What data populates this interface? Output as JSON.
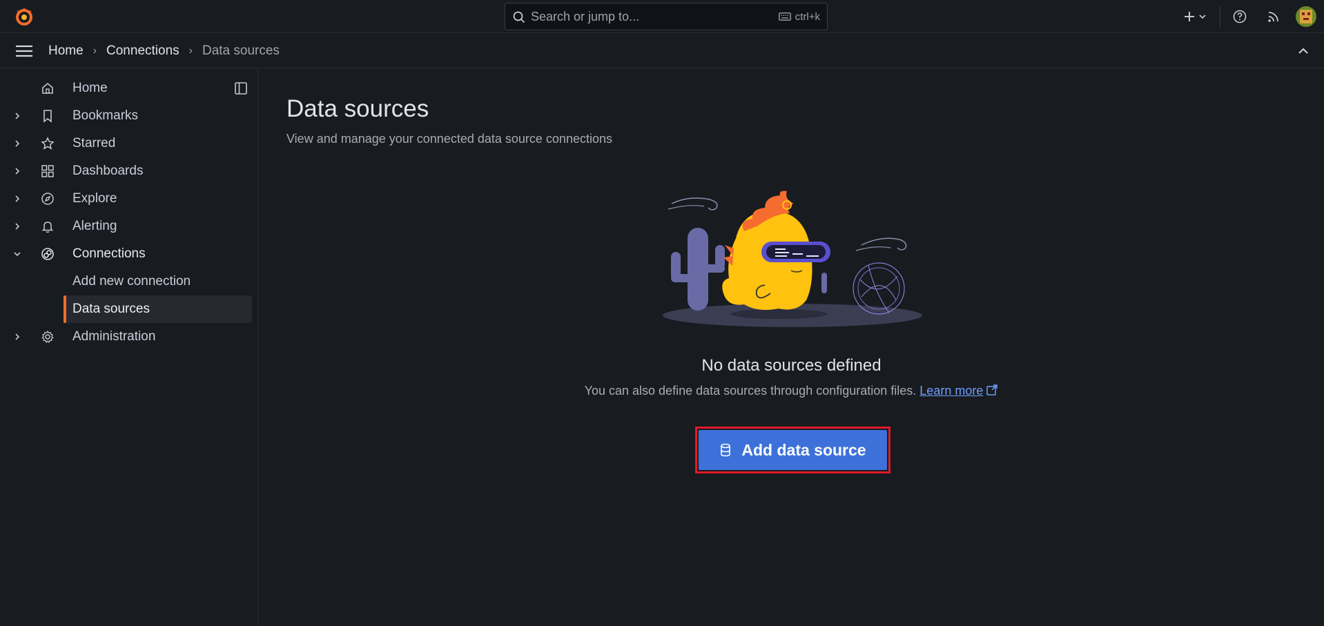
{
  "topbar": {
    "search_placeholder": "Search or jump to...",
    "shortcut": "ctrl+k",
    "icons": [
      "grafana-logo-icon",
      "plus-icon",
      "help-icon",
      "news-feed-icon",
      "user-avatar"
    ]
  },
  "breadcrumb": [
    "Home",
    "Connections",
    "Data sources"
  ],
  "sidebar": {
    "items": [
      {
        "label": "Home",
        "icon": "home-icon"
      },
      {
        "label": "Bookmarks",
        "icon": "bookmark-icon"
      },
      {
        "label": "Starred",
        "icon": "star-icon"
      },
      {
        "label": "Dashboards",
        "icon": "apps-icon"
      },
      {
        "label": "Explore",
        "icon": "compass-icon"
      },
      {
        "label": "Alerting",
        "icon": "bell-icon"
      },
      {
        "label": "Connections",
        "icon": "link-icon"
      },
      {
        "label": "Administration",
        "icon": "cog-icon"
      }
    ],
    "connections_children": [
      {
        "label": "Add new connection"
      },
      {
        "label": "Data sources"
      }
    ]
  },
  "main": {
    "title": "Data sources",
    "subtitle": "View and manage your connected data source connections",
    "empty_title": "No data sources defined",
    "empty_desc": "You can also define data sources through configuration files.",
    "learn_more": "Learn more",
    "add_button": "Add data source"
  },
  "colors": {
    "background": "#181b1f",
    "accent_orange": "#f46c2f",
    "primary_button": "#3d71d9",
    "highlight_border": "#e0192a",
    "link": "#6e9fff"
  }
}
